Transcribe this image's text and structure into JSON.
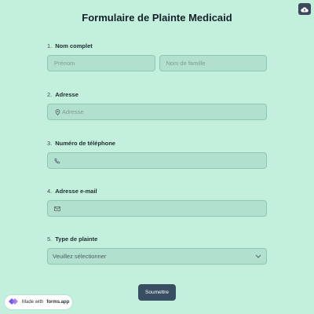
{
  "form": {
    "title": "Formulaire de Plainte Medicaid",
    "questions": [
      {
        "number": "1.",
        "label": "Nom complet",
        "first_placeholder": "Prénom",
        "last_placeholder": "Nom de famille"
      },
      {
        "number": "2.",
        "label": "Adresse",
        "placeholder": "Adresse",
        "icon": "location-pin-icon"
      },
      {
        "number": "3.",
        "label": "Numéro de téléphone",
        "placeholder": "",
        "icon": "phone-icon"
      },
      {
        "number": "4.",
        "label": "Adresse e-mail",
        "placeholder": "",
        "icon": "mail-icon"
      },
      {
        "number": "5.",
        "label": "Type de plainte",
        "selected": "Veuillez sélectionner",
        "icon": "chevron-down-icon"
      }
    ],
    "submit_label": "Soumettre"
  },
  "badge": {
    "prefix": "Made with",
    "brand": "forms.app"
  },
  "toolbar": {
    "icon": "cloud-upload-icon"
  },
  "colors": {
    "background": "#c3f0dc",
    "field": "#b2e0ce",
    "submit": "#3a4e63"
  }
}
